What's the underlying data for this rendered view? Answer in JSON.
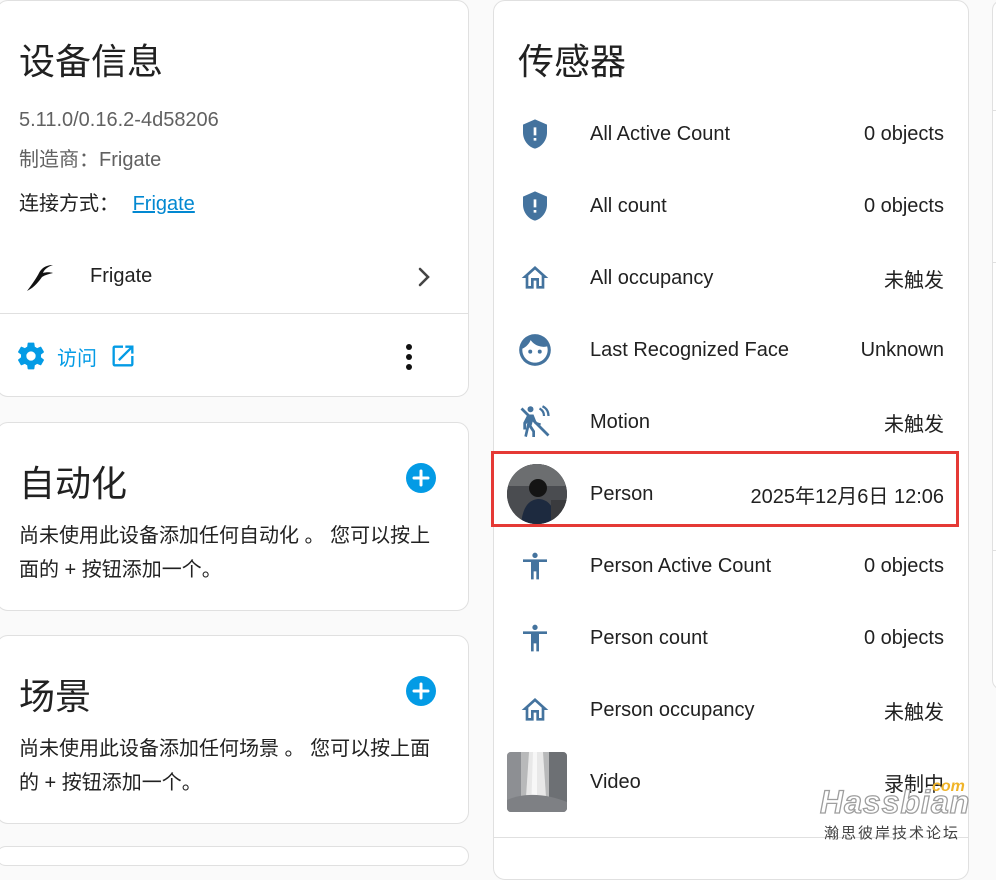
{
  "device_info": {
    "title": "设备信息",
    "version": "5.11.0/0.16.2-4d58206",
    "manufacturer": "制造商：Frigate",
    "connection_label": "连接方式：",
    "connection_link": "Frigate",
    "integration_name": "Frigate",
    "visit_label": "访问"
  },
  "automation": {
    "title": "自动化",
    "description": "尚未使用此设备添加任何自动化 。 您可以按上面的 + 按钮添加一个。"
  },
  "scene": {
    "title": "场景",
    "description": "尚未使用此设备添加任何场景 。 您可以按上面的 + 按钮添加一个。"
  },
  "sensors": {
    "title": "传感器",
    "items": [
      {
        "icon": "shield-alert-icon",
        "name": "All Active Count",
        "value": "0 objects"
      },
      {
        "icon": "shield-alert-icon",
        "name": "All count",
        "value": "0 objects"
      },
      {
        "icon": "home-outline-icon",
        "name": "All occupancy",
        "value": "未触发"
      },
      {
        "icon": "face-recognition-icon",
        "name": "Last Recognized Face",
        "value": "Unknown"
      },
      {
        "icon": "motion-sensor-off-icon",
        "name": "Motion",
        "value": "未触发"
      },
      {
        "icon": "person-thumbnail",
        "name": "Person",
        "value": "2025年12月6日 12:06"
      },
      {
        "icon": "human-icon",
        "name": "Person Active Count",
        "value": "0 objects"
      },
      {
        "icon": "human-icon",
        "name": "Person count",
        "value": "0 objects"
      },
      {
        "icon": "home-outline-icon",
        "name": "Person occupancy",
        "value": "未触发"
      },
      {
        "icon": "video-thumbnail",
        "name": "Video",
        "value": "录制中"
      }
    ]
  },
  "watermark": {
    "brand": "Hassbian",
    "suffix": "com",
    "subtitle": "瀚思彼岸技术论坛"
  },
  "colors": {
    "accent": "#039be5",
    "icon_blue": "#44739e",
    "highlight": "#e53935"
  }
}
